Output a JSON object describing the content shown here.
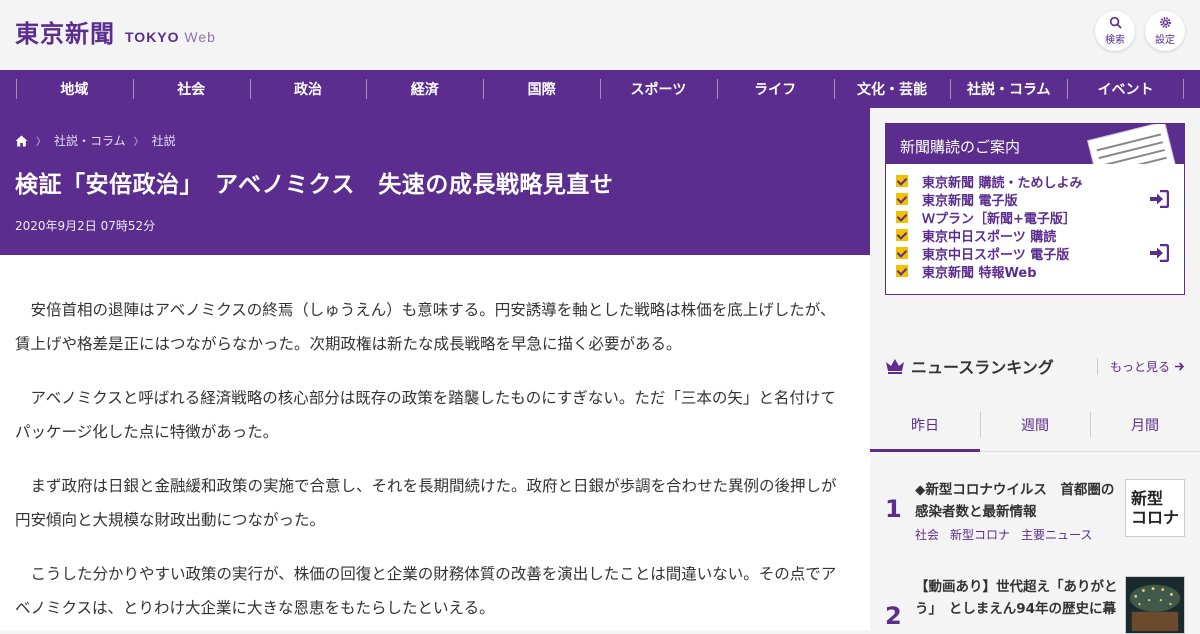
{
  "logo": {
    "kanji": "東京新聞",
    "en_bold": "TOKYO",
    "en_light": "Web"
  },
  "topbar": {
    "search_label": "検索",
    "settings_label": "設定"
  },
  "nav": [
    "地域",
    "社会",
    "政治",
    "経済",
    "国際",
    "スポーツ",
    "ライフ",
    "文化・芸能",
    "社説・コラム",
    "イベント"
  ],
  "breadcrumb": [
    "社説・コラム",
    "社説"
  ],
  "article": {
    "title": "検証「安倍政治」　アベノミクス　失速の成長戦略見直せ",
    "date": "2020年9月2日 07時52分",
    "paragraphs": [
      "　安倍首相の退陣はアベノミクスの終焉（しゅうえん）も意味する。円安誘導を軸とした戦略は株価を底上げしたが、賃上げや格差是正にはつながらなかった。次期政権は新たな成長戦略を早急に描く必要がある。",
      "　アベノミクスと呼ばれる経済戦略の核心部分は既存の政策を踏襲したものにすぎない。ただ「三本の矢」と名付けてパッケージ化した点に特徴があった。",
      "　まず政府は日銀と金融緩和政策の実施で合意し、それを長期間続けた。政府と日銀が歩調を合わせた異例の後押しが円安傾向と大規模な財政出動につながった。",
      "　こうした分かりやすい政策の実行が、株価の回復と企業の財務体質の改善を演出したことは間違いない。その点でアベノミクスは、とりわけ大企業に大きな恩恵をもたらしたといえる。"
    ]
  },
  "promo": {
    "heading": "新聞購読のご案内",
    "links": [
      {
        "label": "東京新聞 購読・ためしよみ",
        "login": false
      },
      {
        "label": "東京新聞 電子版",
        "login": true
      },
      {
        "label": "Ｗプラン［新聞+電子版］",
        "login": false
      },
      {
        "label": "東京中日スポーツ 購読",
        "login": false
      },
      {
        "label": "東京中日スポーツ 電子版",
        "login": true
      },
      {
        "label": "東京新聞 特報Web",
        "login": false
      }
    ]
  },
  "ranking": {
    "title": "ニュースランキング",
    "more": "もっと見る",
    "tabs": [
      "昨日",
      "週間",
      "月間"
    ],
    "active_tab": 0,
    "items": [
      {
        "rank": "1",
        "text": "◆新型コロナウイルス　首都圏の感染者数と最新情報",
        "tags": [
          "社会",
          "新型コロナ",
          "主要ニュース"
        ],
        "thumb": "新型\nコロナ"
      },
      {
        "rank": "2",
        "text": "【動画あり】世代超え「ありがとう」　としまえん94年の歴史に幕",
        "tags": [],
        "thumb": ""
      }
    ]
  },
  "colors": {
    "brand": "#5b2d8e",
    "check": "#f2c200"
  }
}
